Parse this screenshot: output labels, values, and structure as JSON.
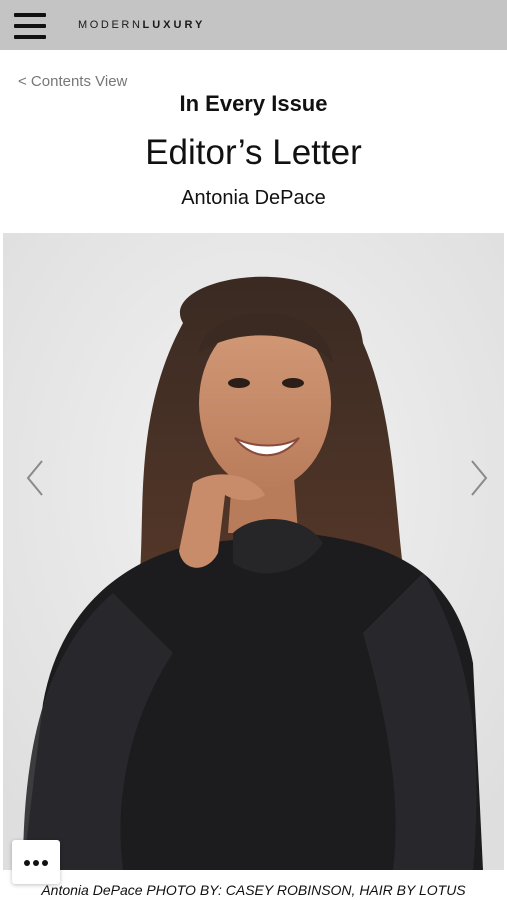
{
  "header": {
    "menu_icon": "hamburger-menu-icon",
    "logo_light": "MODERN",
    "logo_bold": "LUXURY"
  },
  "nav": {
    "back_label": "< Contents View"
  },
  "article": {
    "section": "In Every Issue",
    "title": "Editor’s Letter",
    "author": "Antonia DePace",
    "caption": "Antonia DePace PHOTO BY: CASEY ROBINSON, HAIR BY LOTUS"
  },
  "gallery": {
    "prev_icon": "chevron-left-icon",
    "next_icon": "chevron-right-icon"
  },
  "actions": {
    "more_icon": "more-dots-icon"
  }
}
